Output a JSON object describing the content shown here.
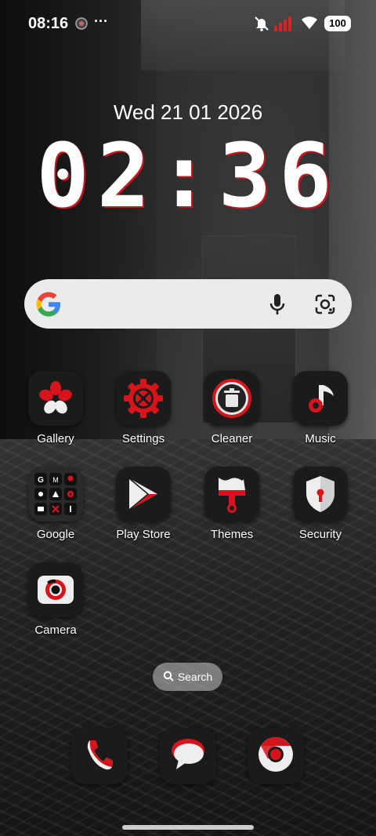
{
  "status_bar": {
    "time": "08:16",
    "more": "···",
    "battery": "100"
  },
  "lockclock": {
    "date": "Wed 21 01 2026",
    "time": "02:36"
  },
  "search_widget": {
    "google_icon": "google-g-icon",
    "mic_icon": "mic-icon",
    "lens_icon": "lens-icon"
  },
  "apps": [
    {
      "label": "Gallery"
    },
    {
      "label": "Settings"
    },
    {
      "label": "Cleaner"
    },
    {
      "label": "Music"
    },
    {
      "label": "Google"
    },
    {
      "label": "Play Store"
    },
    {
      "label": "Themes"
    },
    {
      "label": "Security"
    },
    {
      "label": "Camera"
    }
  ],
  "search_pill": {
    "label": "Search"
  },
  "dock": [
    {
      "icon": "phone-icon"
    },
    {
      "icon": "messages-icon"
    },
    {
      "icon": "chrome-icon"
    }
  ],
  "colors": {
    "accent": "#d7141b",
    "tile": "#1b1b1b"
  }
}
